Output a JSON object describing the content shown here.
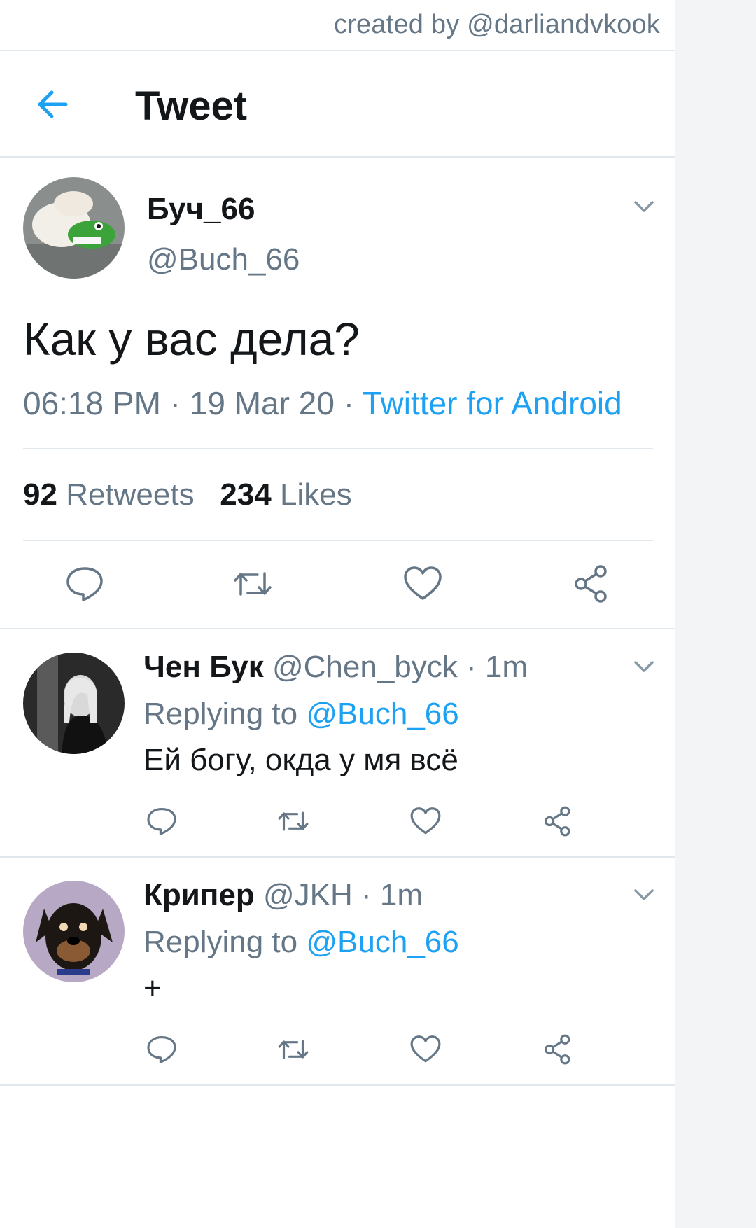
{
  "watermark": "created by @darliandvkook",
  "header": {
    "title": "Tweet",
    "back_icon": "arrow-left-icon"
  },
  "tweet": {
    "author_name": "Буч_66",
    "author_handle": "@Buch_66",
    "text": "Как у вас дела?",
    "time": "06:18 PM",
    "date": "19 Mar 20",
    "separator": " · ",
    "source": "Twitter for Android",
    "retweets_count": "92",
    "retweets_label": "Retweets",
    "likes_count": "234",
    "likes_label": "Likes"
  },
  "replies": [
    {
      "name": "Чен Бук",
      "handle": "@Chen_byck",
      "time": "1m",
      "replying_label": "Replying to",
      "replying_handle": "@Buch_66",
      "text": "Ей богу, окда у мя всё"
    },
    {
      "name": "Крипер",
      "handle": "@JKH",
      "time": "1m",
      "replying_label": "Replying to",
      "replying_handle": "@Buch_66",
      "text": "+"
    }
  ],
  "action_icons": [
    "reply-icon",
    "retweet-icon",
    "like-icon",
    "share-icon"
  ],
  "colors": {
    "accent": "#1da1f2",
    "text": "#14171a",
    "secondary": "#657786",
    "divider": "#e1e8ed"
  }
}
